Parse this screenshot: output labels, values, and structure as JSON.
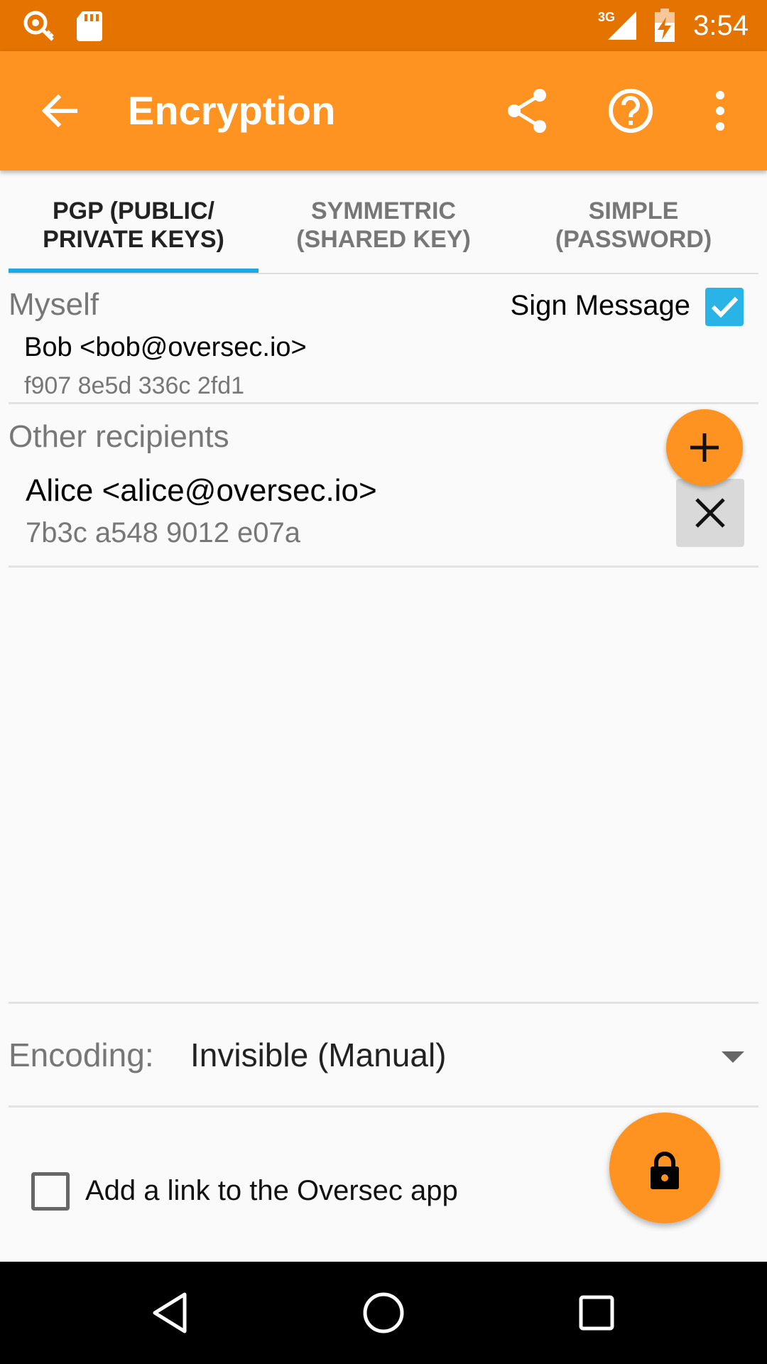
{
  "status_bar": {
    "time": "3:54",
    "network_type": "3G",
    "icons": [
      "oversec-key-icon",
      "sd-card-icon",
      "signal-icon",
      "battery-charging-icon"
    ]
  },
  "app_bar": {
    "title": "Encryption",
    "icons": [
      "back-arrow-icon",
      "share-icon",
      "help-icon",
      "overflow-menu-icon"
    ]
  },
  "tabs": [
    {
      "line1": "PGP (PUBLIC/",
      "line2": "PRIVATE KEYS)",
      "active": true
    },
    {
      "line1": "SYMMETRIC",
      "line2": "(SHARED KEY)",
      "active": false
    },
    {
      "line1": "SIMPLE",
      "line2": "(PASSWORD)",
      "active": false
    }
  ],
  "myself": {
    "label": "Myself",
    "name": "Bob <bob@oversec.io>",
    "key_id": "f907 8e5d 336c 2fd1",
    "sign_message_label": "Sign Message",
    "sign_message_checked": true
  },
  "recipients": {
    "label": "Other recipients",
    "items": [
      {
        "name": "Alice <alice@oversec.io>",
        "key_id": "7b3c a548 9012 e07a"
      }
    ],
    "add_icon": "plus-icon",
    "remove_icon": "close-icon"
  },
  "encoding": {
    "label": "Encoding:",
    "value": "Invisible (Manual)"
  },
  "add_link": {
    "label": "Add a link to the Oversec app",
    "checked": false
  },
  "encrypt_fab_icon": "lock-icon",
  "colors": {
    "status_bar": "#e57300",
    "app_bar": "#ff9322",
    "accent": "#1ea7e1",
    "fab": "#ff9322"
  },
  "nav_bar": {
    "icons": [
      "back-triangle-icon",
      "home-circle-icon",
      "recents-square-icon"
    ]
  }
}
